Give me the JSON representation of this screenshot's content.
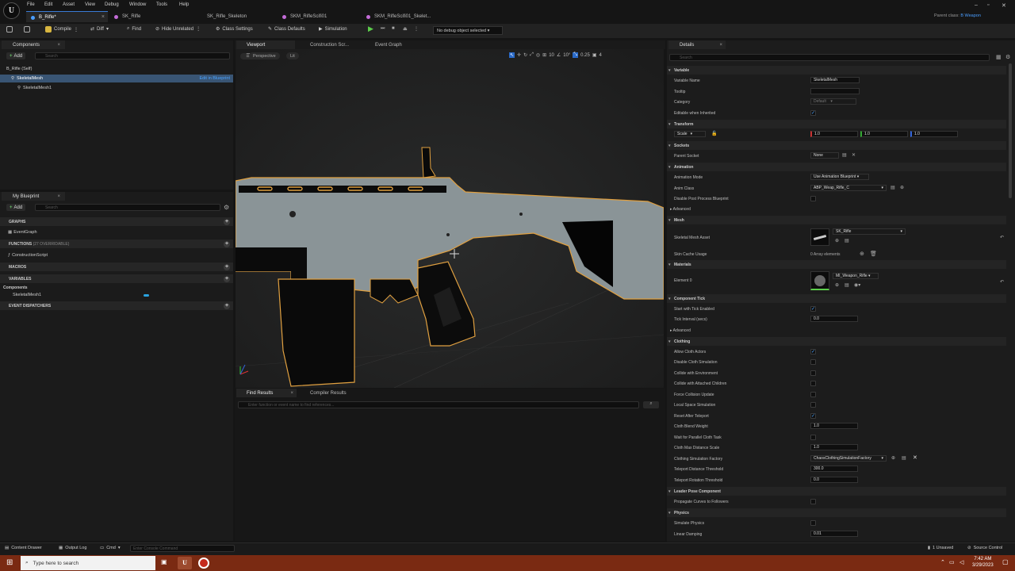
{
  "menu": [
    "File",
    "Edit",
    "Asset",
    "View",
    "Debug",
    "Window",
    "Tools",
    "Help"
  ],
  "tabs": [
    {
      "label": "B_Rifle*",
      "color": "#4a9eff",
      "active": true
    },
    {
      "label": "SK_Rifle",
      "color": "#c46cd8",
      "active": false
    },
    {
      "label": "SK_Rifle_Skeleton",
      "color": "#6a6a6a",
      "active": false
    },
    {
      "label": "SKM_RifleScifi01",
      "color": "#c46cd8",
      "active": false
    },
    {
      "label": "SKM_RifleScifi01_Skelet...",
      "color": "#c46cd8",
      "active": false
    }
  ],
  "parent_class": {
    "label": "Parent class:",
    "value": "B Weapon"
  },
  "toolbar": {
    "compile": "Compile",
    "diff": "Diff",
    "find": "Find",
    "hide_unrelated": "Hide Unrelated",
    "class_settings": "Class Settings",
    "class_defaults": "Class Defaults",
    "simulation": "Simulation",
    "debug": "No debug object selected"
  },
  "components": {
    "title": "Components",
    "add": "Add",
    "search": "Search",
    "root": "B_Rifle (Self)",
    "selected": "SkeletalMesh",
    "edit": "Edit in Blueprint",
    "child": "SkeletalMesh1"
  },
  "blueprint": {
    "title": "My Blueprint",
    "add": "Add",
    "search": "Search",
    "graphs": "GRAPHS",
    "event_graph": "EventGraph",
    "functions": "FUNCTIONS",
    "overridable": "(27 OVERRIDABLE)",
    "construction": "ConstructionScript",
    "macros": "MACROS",
    "variables": "VARIABLES",
    "components_cat": "Components",
    "var1": "SkeletalMesh1",
    "dispatchers": "EVENT DISPATCHERS"
  },
  "viewport_tabs": [
    "Viewport",
    "Construction Scr...",
    "Event Graph"
  ],
  "viewport": {
    "perspective": "Perspective",
    "lit": "Lit",
    "grid": "10",
    "angle": "10°",
    "scale": "0.25",
    "cam": "4"
  },
  "bottom": {
    "find": "Find Results",
    "compiler": "Compiler Results",
    "search": "Enter function or event name to find references..."
  },
  "details": {
    "title": "Details",
    "search": "Search",
    "variable": "Variable",
    "variable_name": {
      "label": "Variable Name",
      "value": "SkeletalMesh"
    },
    "tooltip": "Tooltip",
    "category": {
      "label": "Category",
      "value": "Default"
    },
    "editable": "Editable when Inherited",
    "transform": "Transform",
    "scale": {
      "label": "Scale",
      "x": "1.0",
      "y": "1.0",
      "z": "1.0"
    },
    "sockets": "Sockets",
    "parent_socket": {
      "label": "Parent Socket",
      "value": "None"
    },
    "animation": "Animation",
    "anim_mode": {
      "label": "Animation Mode",
      "value": "Use Animation Blueprint"
    },
    "anim_class": {
      "label": "Anim Class",
      "value": "ABP_Weap_Rifle_C"
    },
    "disable_pp": "Disable Post Process Blueprint",
    "advanced": "Advanced",
    "mesh": "Mesh",
    "skel_asset": {
      "label": "Skeletal Mesh Asset",
      "value": "SK_Rifle"
    },
    "skin_cache": {
      "label": "Skin Cache Usage",
      "value": "0 Array elements"
    },
    "materials": "Materials",
    "element0": {
      "label": "Element 0",
      "value": "MI_Weapon_Rifle"
    },
    "component_tick": "Component Tick",
    "start_tick": "Start with Tick Enabled",
    "tick_interval": {
      "label": "Tick Interval (secs)",
      "value": "0.0"
    },
    "advanced2": "Advanced",
    "clothing": "Clothing",
    "allow_cloth": "Allow Cloth Actors",
    "disable_cloth": "Disable Cloth Simulation",
    "collide_env": "Collide with Environment",
    "collide_children": "Collide with Attached Children",
    "force_collision": "Force Collision Update",
    "local_space": "Local Space Simulation",
    "reset_teleport": "Reset After Teleport",
    "blend_weight": {
      "label": "Cloth Blend Weight",
      "value": "1.0"
    },
    "wait_parallel": "Wait for Parallel Cloth Task",
    "max_distance": {
      "label": "Cloth Max Distance Scale",
      "value": "1.0"
    },
    "sim_factory": {
      "label": "Clothing Simulation Factory",
      "value": "ChaosClothingSimulationFactory"
    },
    "teleport_dist": {
      "label": "Teleport Distance Threshold",
      "value": "300.0"
    },
    "teleport_rot": {
      "label": "Teleport Rotation Threshold",
      "value": "0.0"
    },
    "leader_pose": "Leader Pose Component",
    "propagate": "Propagate Curves to Followers",
    "physics": "Physics",
    "simulate": "Simulate Physics",
    "linear_damping": {
      "label": "Linear Damping",
      "value": "0.01"
    }
  },
  "status": {
    "content_drawer": "Content Drawer",
    "output_log": "Output Log",
    "cmd": "Cmd",
    "console": "Enter Console Command",
    "unsaved": "1 Unsaved",
    "source": "Source Control"
  },
  "taskbar": {
    "search": "Type here to search",
    "time": "7:42 AM",
    "date": "3/29/2023"
  }
}
